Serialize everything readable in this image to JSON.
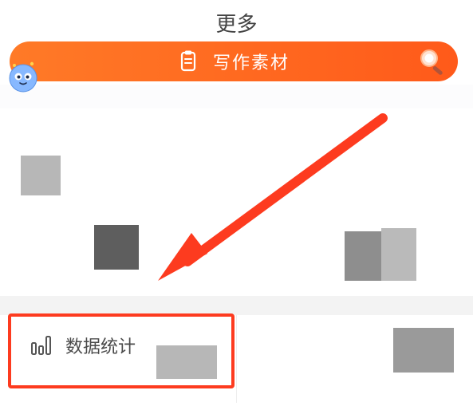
{
  "header": {
    "title": "更多"
  },
  "action_bar": {
    "label": "写作素材",
    "doc_icon": "document-icon",
    "search_icon": "search-icon",
    "mascot": "mascot-icon"
  },
  "menu": {
    "items": [
      {
        "icon": "bar-chart-icon",
        "label": "数据统计"
      },
      {
        "icon": "",
        "label": ""
      }
    ]
  },
  "annotation": {
    "arrow": "arrow-pointer",
    "highlight_box": "highlight-rect"
  },
  "colors": {
    "accent_orange_start": "#ff7a27",
    "accent_orange_end": "#ff5a1a",
    "highlight_red": "#fd3b1f",
    "text": "#4a4a4a"
  }
}
